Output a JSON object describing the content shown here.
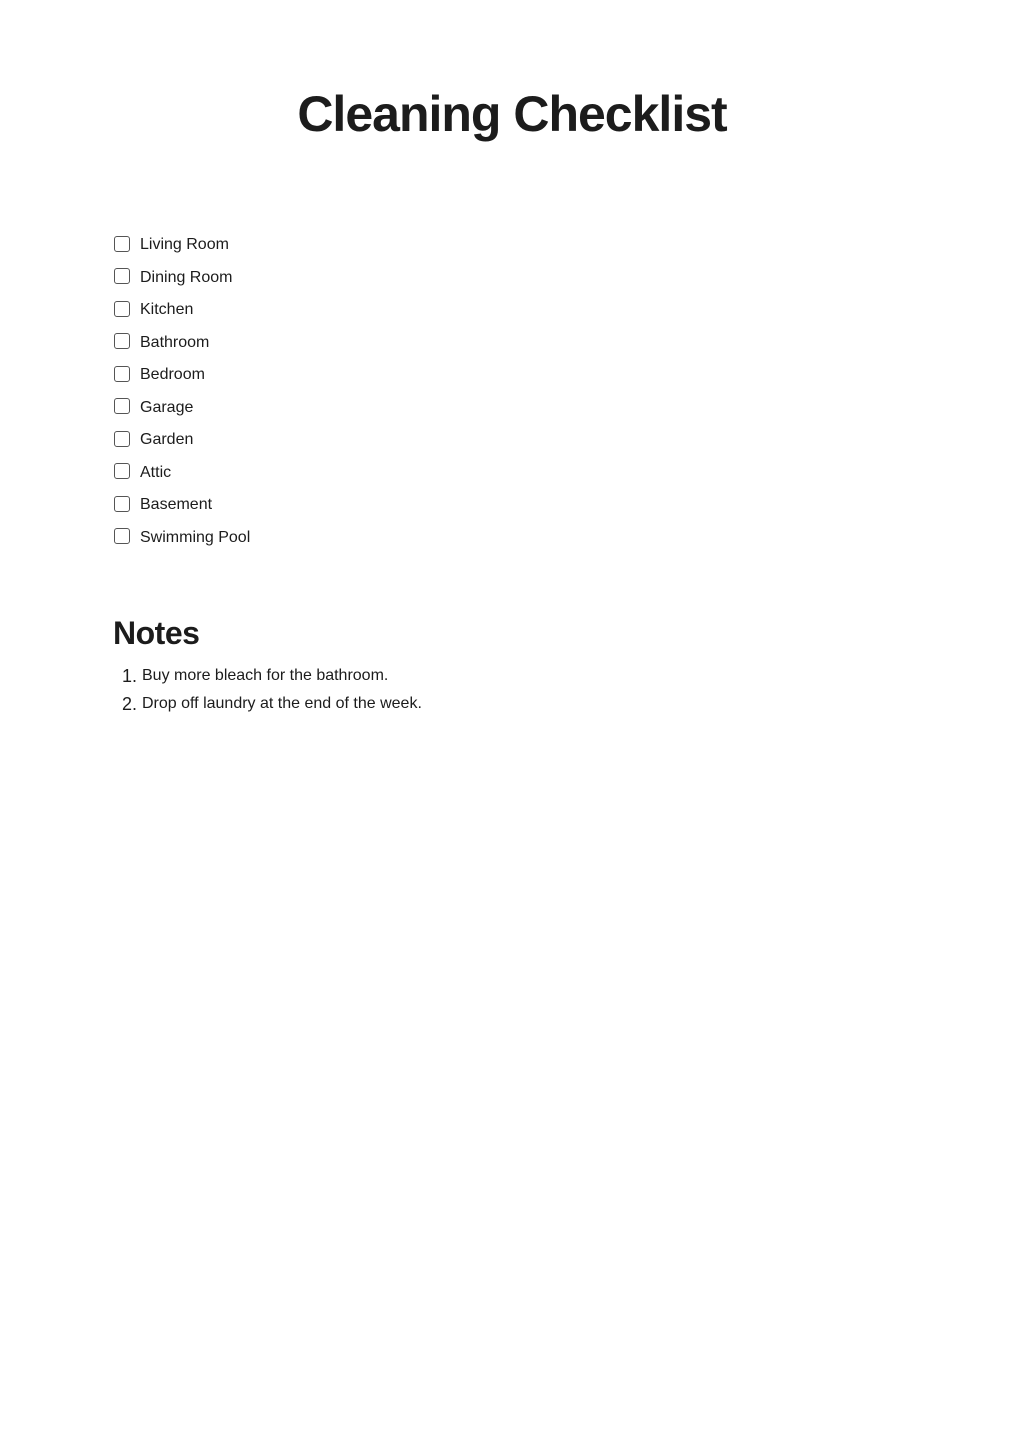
{
  "document": {
    "title": "Cleaning Checklist"
  },
  "checklist": {
    "items": [
      {
        "label": "Living Room",
        "checked": false
      },
      {
        "label": "Dining Room",
        "checked": false
      },
      {
        "label": "Kitchen",
        "checked": false
      },
      {
        "label": "Bathroom",
        "checked": false
      },
      {
        "label": "Bedroom",
        "checked": false
      },
      {
        "label": "Garage",
        "checked": false
      },
      {
        "label": "Garden",
        "checked": false
      },
      {
        "label": "Attic",
        "checked": false
      },
      {
        "label": "Basement",
        "checked": false
      },
      {
        "label": "Swimming Pool",
        "checked": false
      }
    ]
  },
  "notes": {
    "heading": "Notes",
    "items": [
      {
        "number": "1.",
        "text": "Buy more bleach for the bathroom."
      },
      {
        "number": "2.",
        "text": "Drop off laundry at the end of the week."
      }
    ]
  },
  "colors": {
    "text": "#1c1c1c",
    "checkbox_border": "#555555",
    "background": "#ffffff"
  }
}
